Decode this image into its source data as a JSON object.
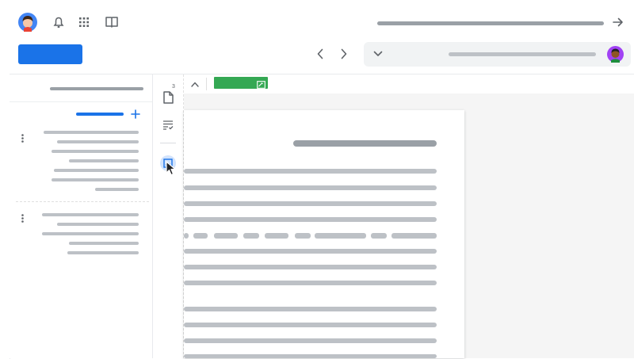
{
  "header": {
    "avatar_icon": "user-avatar-icon",
    "notifications_icon": "bell-icon",
    "apps_icon": "apps-grid-icon",
    "feedback_icon": "book-open-icon",
    "forward_icon": "arrow-right-icon"
  },
  "toolbar": {
    "primary_button_label": "",
    "prev_icon": "chevron-left-icon",
    "next_icon": "chevron-right-icon",
    "dropdown_icon": "chevron-down-icon"
  },
  "rail": {
    "document_badge": "3",
    "document_icon": "document-icon",
    "checklist_icon": "checklist-icon",
    "image_icon": "image-icon"
  },
  "subtoolbar": {
    "collapse_icon": "chevron-up-icon",
    "tag_icon": "image-edit-icon",
    "tag_color": "#34a853"
  },
  "left_panel": {
    "add_icon": "plus-icon"
  },
  "colors": {
    "accent": "#1a73e8",
    "placeholder": "#bdc1c6",
    "header_placeholder": "#9aa0a6"
  }
}
